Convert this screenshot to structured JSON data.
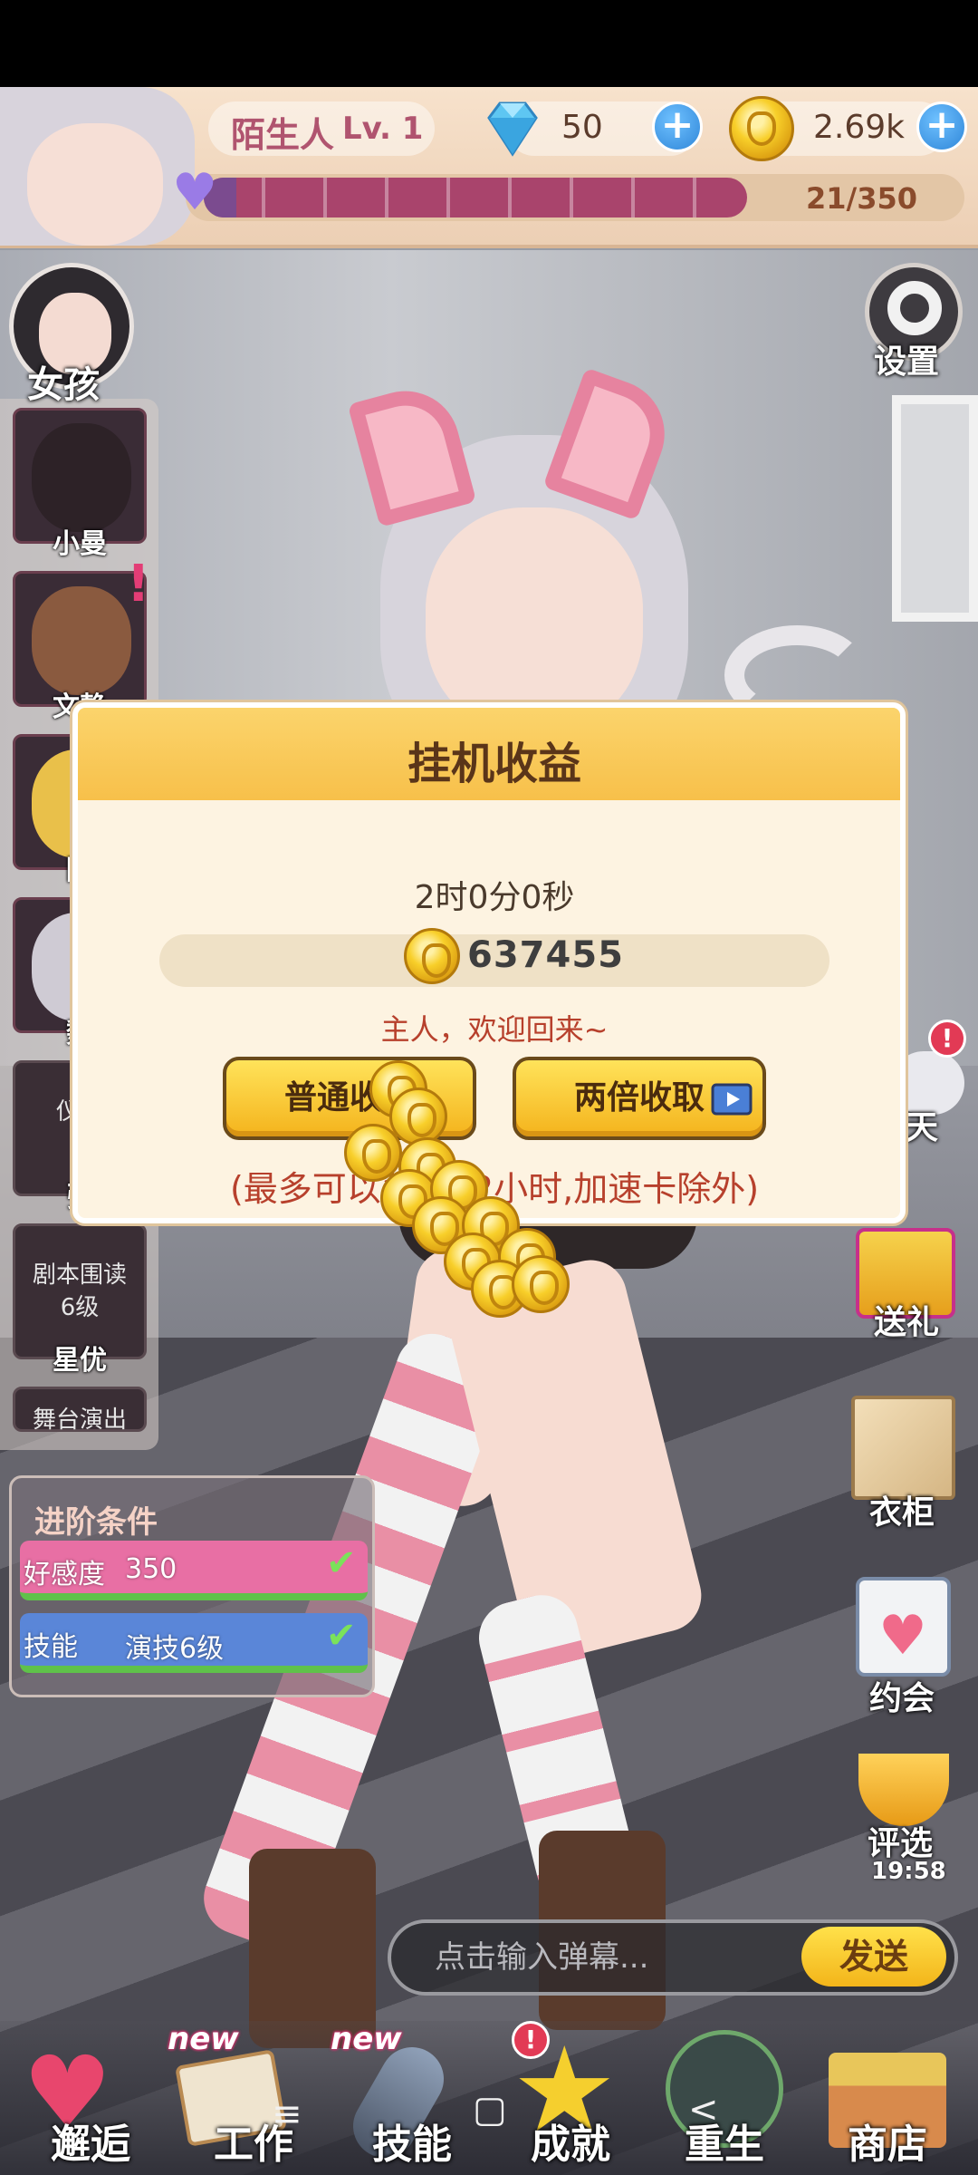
{
  "player": {
    "name": "陌生人",
    "level": "Lv. 1"
  },
  "resources": {
    "gems": "50",
    "coins": "2.69k"
  },
  "affection": {
    "text": "21/350",
    "value": 21,
    "max": 350
  },
  "left_nav": {
    "girls_label": "女孩",
    "girls": [
      {
        "label": "小曼"
      },
      {
        "label": "文静"
      },
      {
        "label": "陈"
      },
      {
        "label": "魏"
      }
    ],
    "locked": [
      {
        "req": "仪态",
        "level": "6",
        "name": "张"
      },
      {
        "req": "剧本围读",
        "level": "6级",
        "name": "星优"
      },
      {
        "req": "舞台演出"
      }
    ]
  },
  "right_nav": {
    "settings": "设置",
    "chat": "天",
    "gift": "送礼",
    "wardrobe": "衣柜",
    "date": "约会",
    "selection": "评选",
    "selection_timer": "19:58"
  },
  "conditions": {
    "title": "进阶条件",
    "rows": [
      {
        "label": "好感度",
        "value": "350",
        "color": "#e86fa4"
      },
      {
        "label": "技能",
        "value": "演技6级",
        "color": "#5a86d8"
      }
    ]
  },
  "danmaku": {
    "placeholder": "点击输入弹幕...",
    "send": "发送"
  },
  "bottom_nav": [
    {
      "label": "邂逅",
      "tag": ""
    },
    {
      "label": "工作",
      "tag": "new"
    },
    {
      "label": "技能",
      "tag": "new"
    },
    {
      "label": "成就",
      "tag": "!"
    },
    {
      "label": "重生",
      "tag": ""
    },
    {
      "label": "商店",
      "tag": ""
    }
  ],
  "system_nav": {
    "menu": "≡",
    "home": "▢",
    "back": "<"
  },
  "modal": {
    "title": "挂机收益",
    "time": "2时0分0秒",
    "amount": "637455",
    "welcome": "主人，欢迎回来~",
    "btn_normal": "普通收取",
    "btn_double": "两倍收取",
    "note": "(最多可以获得12小时,加速卡除外)"
  },
  "colors": {
    "accent": "#f7c04a",
    "heart_bar": "#a9446c",
    "text_brown": "#5a3519"
  }
}
